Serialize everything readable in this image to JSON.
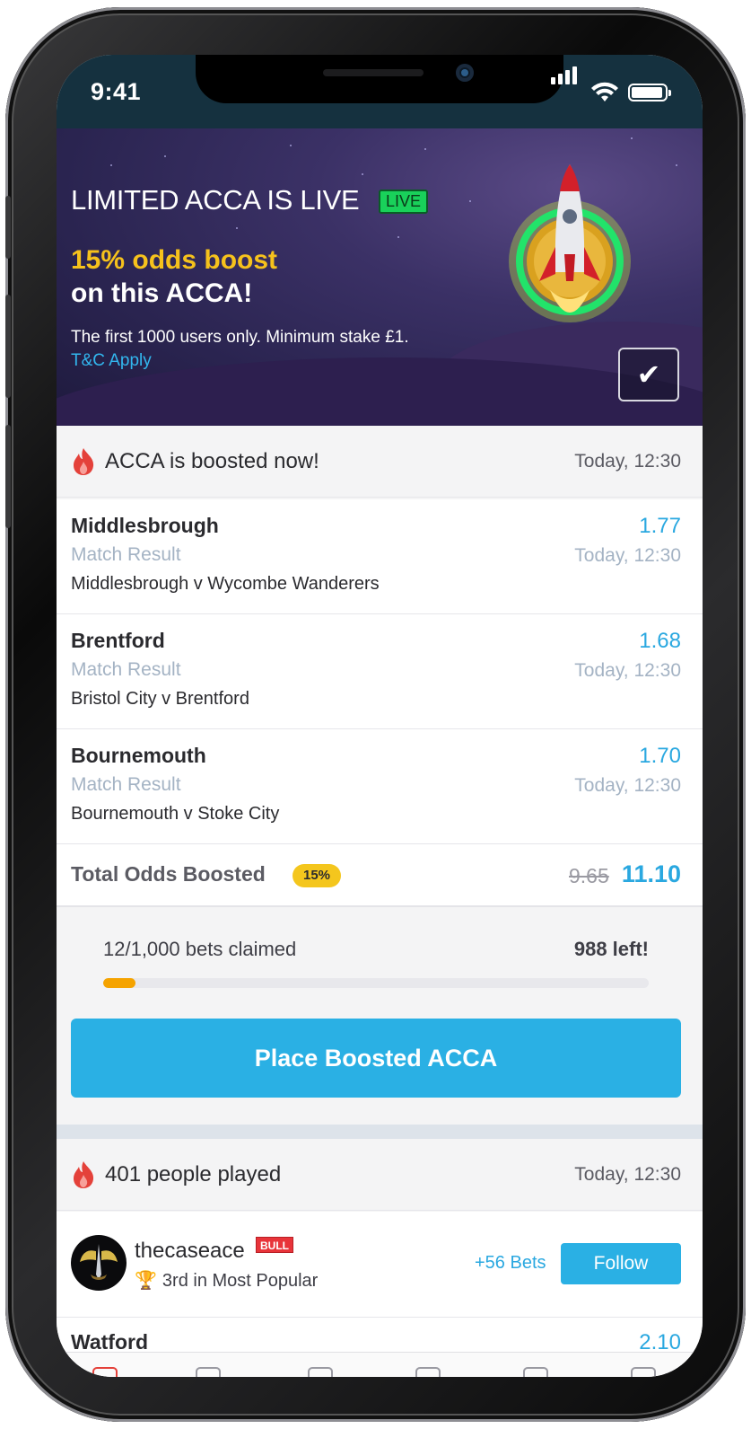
{
  "status_bar": {
    "time": "9:41"
  },
  "banner": {
    "title": "LIMITED ACCA IS LIVE",
    "live_badge": "LIVE",
    "boost_line1": "15% odds boost",
    "boost_line2": "on this ACCA!",
    "subtitle": "The first 1000 users only. Minimum stake £1.",
    "tc_link": "T&C Apply",
    "checkbox_checked": true
  },
  "acca_section": {
    "title": "ACCA is boosted now!",
    "time": "Today, 12:30",
    "selections": [
      {
        "team": "Middlesbrough",
        "market": "Match Result",
        "fixture": "Middlesbrough v Wycombe Wanderers",
        "odds": "1.77",
        "time": "Today, 12:30"
      },
      {
        "team": "Brentford",
        "market": "Match Result",
        "fixture": "Bristol City v Brentford",
        "odds": "1.68",
        "time": "Today, 12:30"
      },
      {
        "team": "Bournemouth",
        "market": "Match Result",
        "fixture": "Bournemouth v Stoke City",
        "odds": "1.70",
        "time": "Today, 12:30"
      }
    ],
    "total": {
      "label": "Total Odds Boosted",
      "boost_pct": "15%",
      "old_odds": "9.65",
      "new_odds": "11.10"
    },
    "claims": {
      "claimed_text": "12/1,000 bets claimed",
      "left_text": "988 left!",
      "progress_fraction": 0.06
    },
    "cta_label": "Place Boosted ACCA"
  },
  "played_section": {
    "title": "401 people played",
    "time": "Today, 12:30",
    "user": {
      "username": "thecaseace",
      "badge": "BULL",
      "rank_text": "3rd  in Most Popular",
      "bets_link": "+56 Bets",
      "follow_label": "Follow"
    },
    "next_selection": {
      "team": "Watford",
      "odds": "2.10"
    }
  },
  "colors": {
    "accent": "#2ab0e4",
    "boost_yellow": "#f6c21c",
    "live_green": "#19d15a",
    "progress_orange": "#f5a300"
  }
}
